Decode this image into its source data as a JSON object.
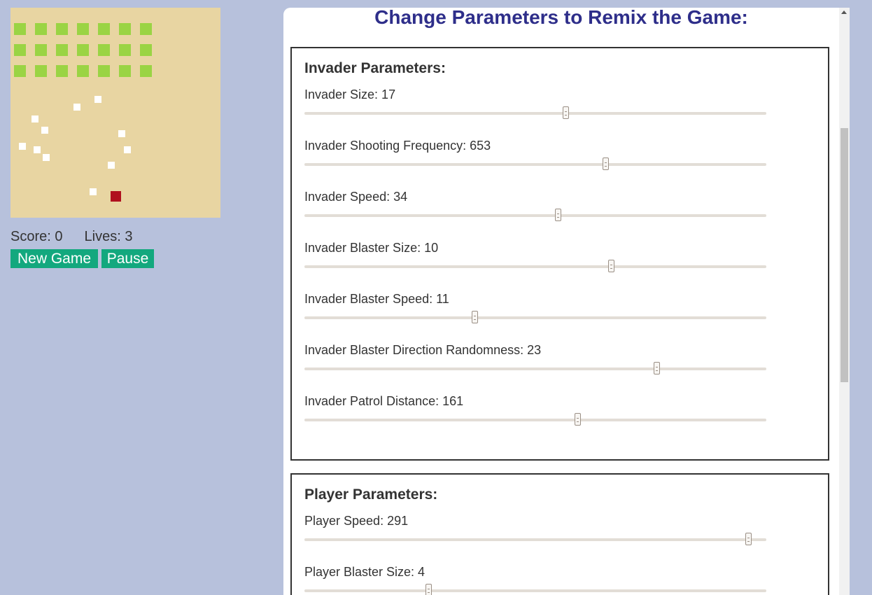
{
  "game": {
    "colors": {
      "board": "#e8d5a2",
      "invader": "#9ad444",
      "projectile": "#ffffff",
      "player": "#b0101e"
    },
    "score_label": "Score:",
    "score": "0",
    "lives_label": "Lives:",
    "lives": "3",
    "new_game_label": "New Game",
    "pause_label": "Pause"
  },
  "panel": {
    "title": "Change Parameters to Remix the Game:",
    "invader_section": {
      "title": "Invader Parameters:",
      "params": [
        {
          "label": "Invader Size: 17",
          "slider_fraction": 0.565
        },
        {
          "label": "Invader Shooting Frequency: 653",
          "slider_fraction": 0.652
        },
        {
          "label": "Invader Speed: 34",
          "slider_fraction": 0.548
        },
        {
          "label": "Invader Blaster Size: 10",
          "slider_fraction": 0.664
        },
        {
          "label": "Invader Blaster Speed: 11",
          "slider_fraction": 0.368
        },
        {
          "label": "Invader Blaster Direction Randomness: 23",
          "slider_fraction": 0.762
        },
        {
          "label": "Invader Patrol Distance: 161",
          "slider_fraction": 0.591
        }
      ]
    },
    "player_section": {
      "title": "Player Parameters:",
      "params": [
        {
          "label": "Player Speed: 291",
          "slider_fraction": 0.961
        },
        {
          "label": "Player Blaster Size: 4",
          "slider_fraction": 0.268
        }
      ]
    }
  }
}
